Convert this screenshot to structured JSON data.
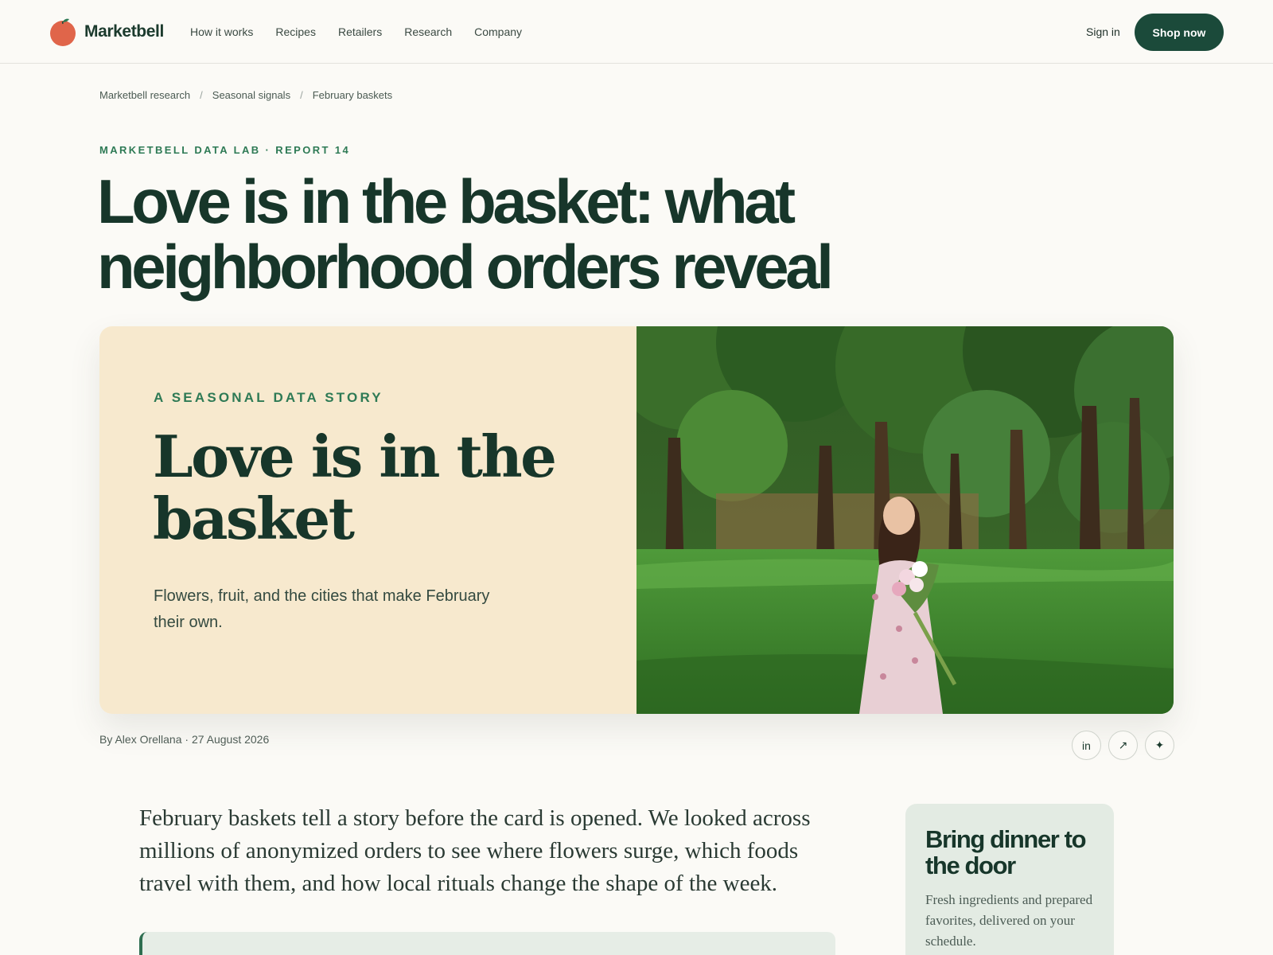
{
  "brand": {
    "name": "Marketbell",
    "logo_icon": "tomato-logo-icon"
  },
  "nav": {
    "items": [
      "How it works",
      "Recipes",
      "Retailers",
      "Research",
      "Company"
    ],
    "signin": "Sign in",
    "shop": "Shop now"
  },
  "breadcrumb": [
    "Marketbell research",
    "Seasonal signals",
    "February baskets"
  ],
  "article": {
    "eyebrow": "MARKETBELL DATA LAB · REPORT 14",
    "headline": "Love is in the basket: what neighborhood orders reveal",
    "byline": "By Alex Orellana · 27 August 2026",
    "lede": "February baskets tell a story before the card is opened. We looked across millions of anonymized orders to see where flowers surge, which foods travel with them, and how local rituals change the shape of the week."
  },
  "hero": {
    "kicker": "A SEASONAL DATA STORY",
    "title": "Love is in the basket",
    "subtitle": "Flowers, fruit, and the cities that make February their own.",
    "image_icon": "park-photo-woman-with-bouquet"
  },
  "share": {
    "linkedin": "in",
    "link": "↗",
    "sparkle": "✦"
  },
  "promo": {
    "title": "Bring dinner to the door",
    "text": "Fresh ingredients and prepared favorites, delivered on your schedule."
  },
  "colors": {
    "primary": "#1b4a3a",
    "accent_green": "#2e7a55",
    "hero_bg": "#f7e9ce",
    "promo_bg": "#e3ebe3",
    "logo_red": "#e0654a"
  }
}
